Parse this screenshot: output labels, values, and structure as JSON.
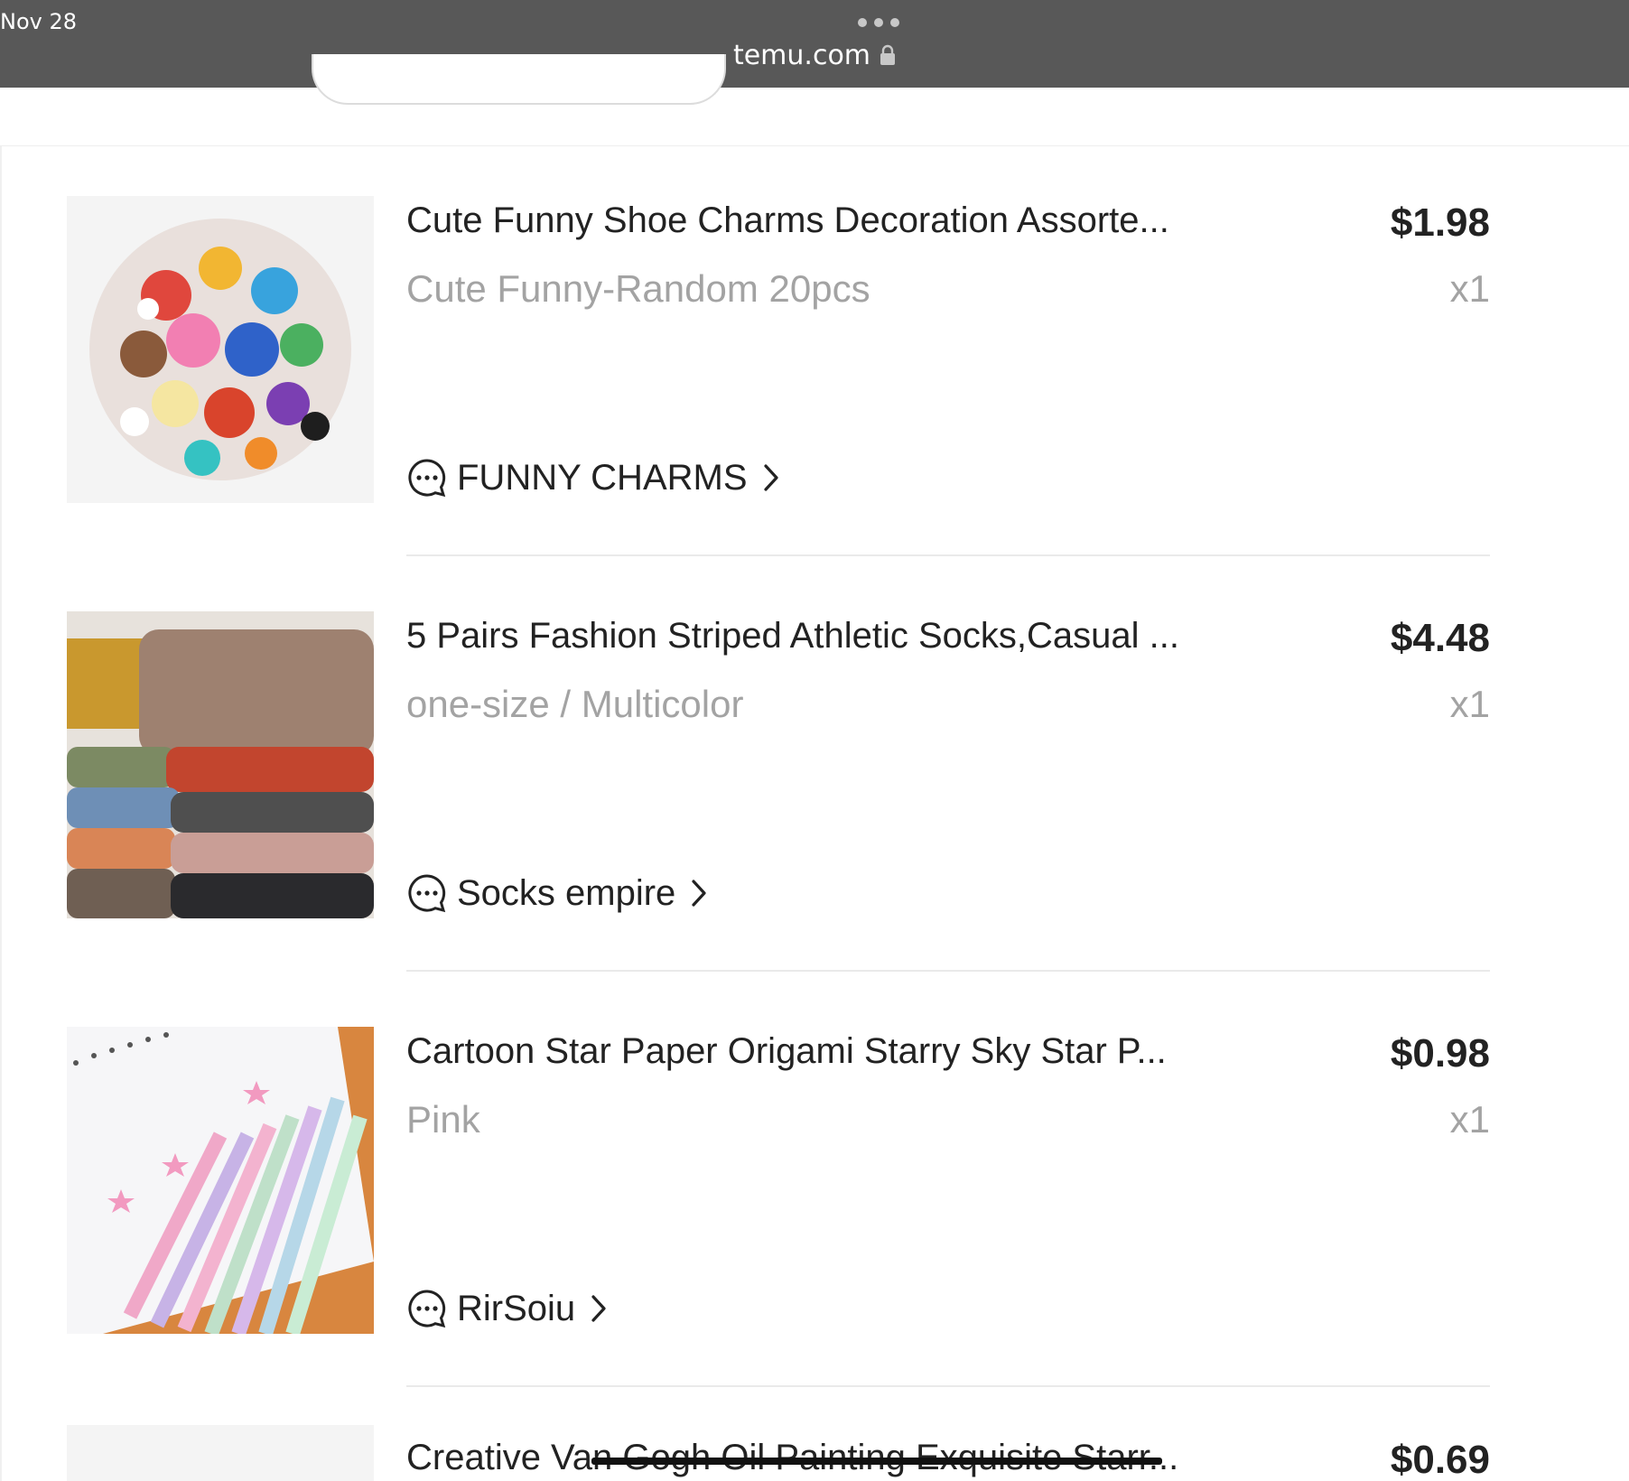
{
  "status_bar": {
    "date": "Nov 28",
    "url": "temu.com"
  },
  "orders": [
    {
      "title": "Cute Funny Shoe Charms Decoration Assorte...",
      "variant": "Cute Funny-Random 20pcs",
      "price": "$1.98",
      "quantity": "x1",
      "store": "FUNNY CHARMS"
    },
    {
      "title": "5 Pairs Fashion Striped Athletic Socks,Casual ...",
      "variant": "one-size / Multicolor",
      "price": "$4.48",
      "quantity": "x1",
      "store": "Socks empire"
    },
    {
      "title": "Cartoon Star Paper Origami Starry Sky Star P...",
      "variant": "Pink",
      "price": "$0.98",
      "quantity": "x1",
      "store": "RirSoiu"
    },
    {
      "title": "Creative Van Gogh Oil Painting Exquisite Starr...",
      "price": "$0.69"
    }
  ],
  "colors": {
    "status_bar_bg": "#585858",
    "variant_text": "#a3a3a3",
    "divider": "#eaeaea"
  }
}
